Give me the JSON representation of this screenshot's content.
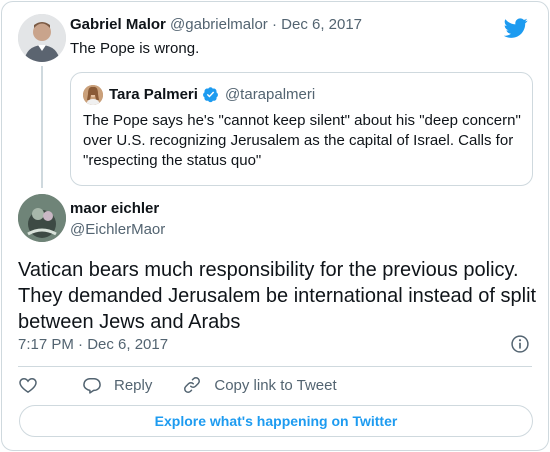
{
  "parent_tweet": {
    "name": "Gabriel Malor",
    "handle": "@gabrielmalor",
    "dot": "·",
    "date": "Dec 6, 2017",
    "text": "The Pope is wrong."
  },
  "quoted_tweet": {
    "name": "Tara Palmeri",
    "handle": "@tarapalmeri",
    "text": "The Pope says he's \"cannot keep silent\" about his \"deep concern\" over U.S. recognizing Jerusalem as the capital of Israel. Calls for \"respecting the status quo\""
  },
  "main_tweet": {
    "name": "maor eichler",
    "handle": "@EichlerMaor",
    "text": "Vatican bears much responsibility for the previous policy. They demanded Jerusalem be international instead of split between Jews and Arabs",
    "timestamp": "7:17 PM · Dec 6, 2017"
  },
  "actions": {
    "reply_label": "Reply",
    "copy_label": "Copy link to Tweet"
  },
  "explore_label": "Explore what's happening on Twitter",
  "icons": [
    "twitter-logo-icon",
    "verified-badge-icon",
    "info-icon",
    "heart-icon",
    "reply-icon",
    "link-icon"
  ],
  "colors": {
    "brand": "#1d9bf0",
    "text": "#0f1419",
    "secondary": "#536471",
    "border": "#cfd9de"
  }
}
